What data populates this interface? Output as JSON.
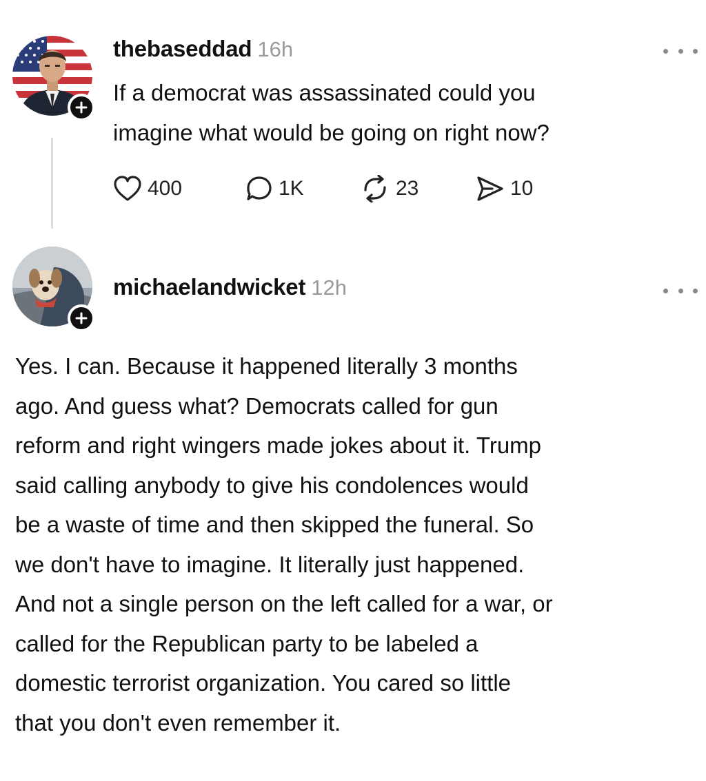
{
  "post": {
    "username": "thebaseddad",
    "time": "16h",
    "text": "If a democrat was assassinated could you\nimagine what would be going on right now?",
    "actions": {
      "likes": "400",
      "replies": "1K",
      "reposts": "23",
      "shares": "10"
    }
  },
  "reply": {
    "username": "michaelandwicket",
    "time": "12h",
    "lines": [
      "Yes. I can. Because it happened literally 3 months",
      "ago. And guess what? Democrats called for gun",
      "reform and right wingers made jokes about it. Trump",
      "said calling anybody to give his condolences would",
      "be a waste of time and then skipped the funeral. So",
      "we don't have to imagine. It literally just happened.",
      "And not a single person on the left called for a war, or",
      "called for the Republican party to be labeled a",
      "domestic terrorist organization. You cared so little",
      "that you don't even remember it."
    ]
  },
  "icons": {
    "more": "more-horizontal-icon",
    "like": "heart-icon",
    "reply": "comment-icon",
    "repost": "repost-icon",
    "share": "send-icon",
    "follow": "plus-icon"
  }
}
